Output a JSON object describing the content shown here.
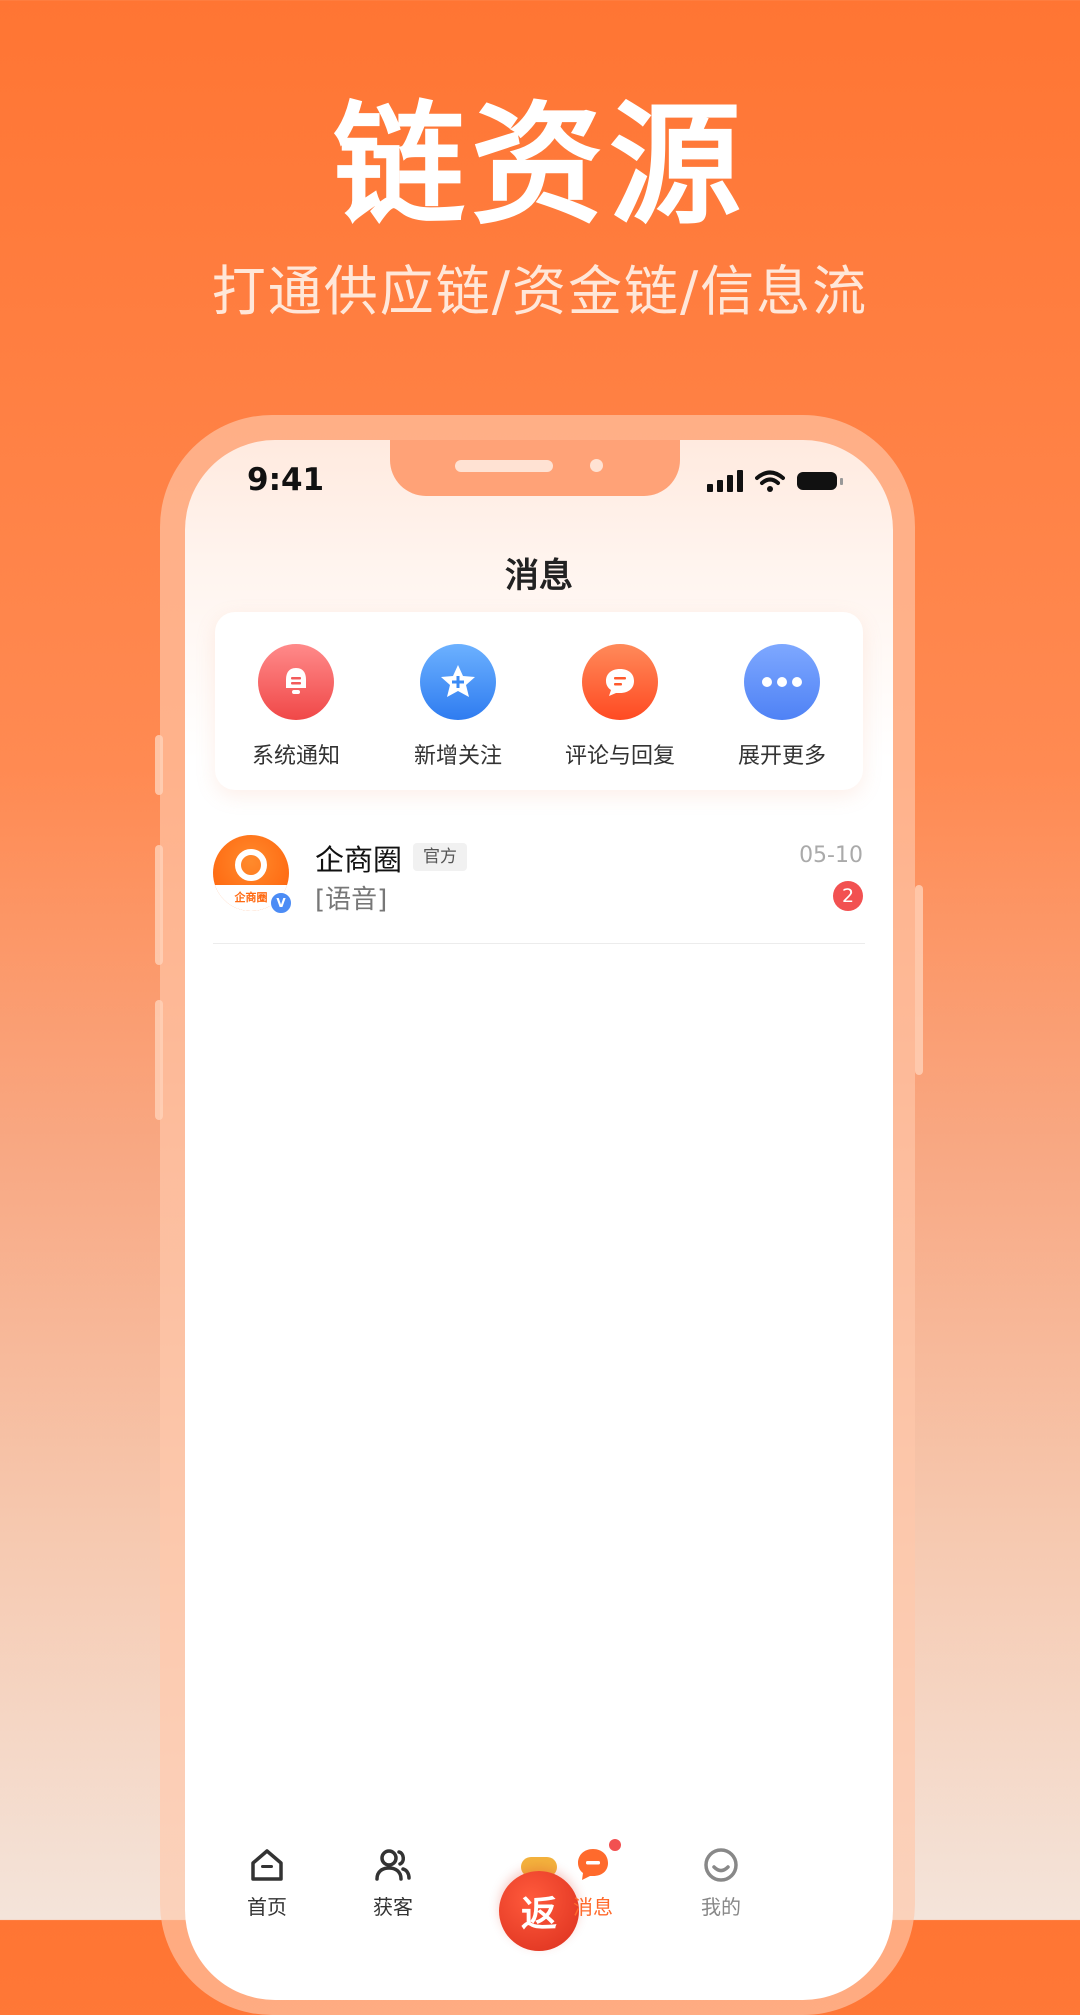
{
  "promo": {
    "headline": "链资源",
    "subline": "打通供应链/资金链/信息流"
  },
  "status_bar": {
    "time": "9:41"
  },
  "page": {
    "title": "消息"
  },
  "quick_actions": [
    {
      "label": "系统通知",
      "icon": "bell-icon",
      "color": "#f45b5b"
    },
    {
      "label": "新增关注",
      "icon": "star-plus-icon",
      "color": "#3a8af5"
    },
    {
      "label": "评论与回复",
      "icon": "chat-bubble-icon",
      "color": "#ff5a2c"
    },
    {
      "label": "展开更多",
      "icon": "more-dots-icon",
      "color": "#5b8ef7"
    }
  ],
  "messages": [
    {
      "sender": "企商圈",
      "tag": "官方",
      "preview": "[语音]",
      "date": "05-10",
      "unread": "2",
      "avatar_text": "企商圈",
      "verified": "V"
    }
  ],
  "tabbar": {
    "home": "首页",
    "customers": "获客",
    "rebate": "返",
    "messages": "消息",
    "profile": "我的",
    "active_color": "#ff6a2c"
  }
}
